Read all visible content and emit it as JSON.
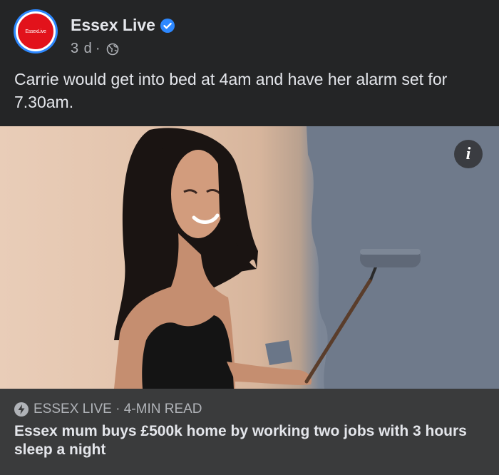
{
  "post": {
    "page_name": "Essex Live",
    "avatar_text": "EssexLive",
    "timestamp": "3 d",
    "separator": "·",
    "privacy_icon": "globe-icon",
    "verified_icon": "verified-badge-icon",
    "text": "Carrie would get into bed at 4am and have her alarm set for 7.30am."
  },
  "link_card": {
    "source": "ESSEX LIVE · 4-MIN READ",
    "source_icon": "lightning-bolt-icon",
    "title": "Essex mum buys £500k home by working two jobs with 3 hours sleep a night"
  },
  "info_button": {
    "label": "i",
    "icon": "info-icon"
  },
  "colors": {
    "background": "#242526",
    "link_card_bg": "#3a3b3c",
    "primary_text": "#e4e6eb",
    "secondary_text": "#b0b3b8",
    "verified_blue": "#2d88ff",
    "brand_red": "#e2121b"
  }
}
